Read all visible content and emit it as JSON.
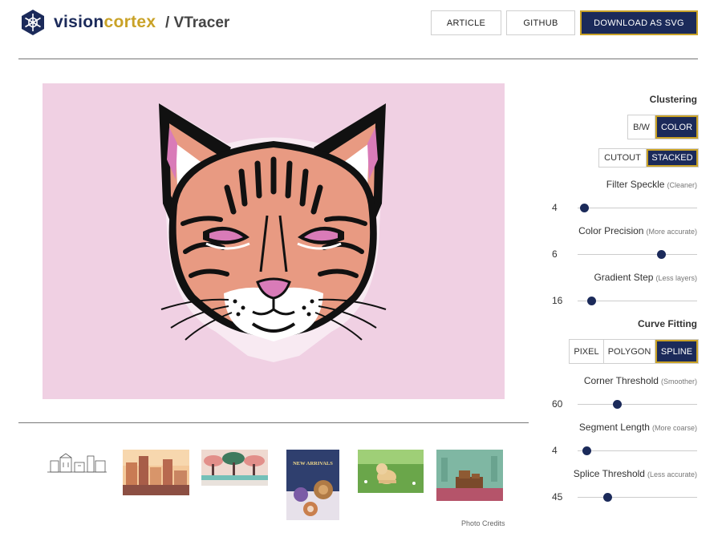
{
  "header": {
    "brand_prefix": "vision",
    "brand_accent": "cortex",
    "product": "/ VTracer",
    "nav": {
      "article": "ARTICLE",
      "github": "GITHUB",
      "download": "DOWNLOAD AS SVG"
    }
  },
  "canvas": {
    "background": "#f0d0e3",
    "subject": "lynx-face"
  },
  "gallery": {
    "thumbnails": [
      "line-drawing-thumbnail",
      "city-skyline-thumbnail",
      "trees-landscape-thumbnail",
      "new-arrivals-poster-thumbnail",
      "dog-on-grass-thumbnail",
      "pixel-art-thumbnail"
    ],
    "poster_text": "NEW ARRIVALS",
    "credits": "Photo Credits"
  },
  "panel": {
    "clustering": {
      "title": "Clustering",
      "mode_options": [
        "B/W",
        "COLOR"
      ],
      "mode_selected": "COLOR",
      "layer_options": [
        "CUTOUT",
        "STACKED"
      ],
      "layer_selected": "STACKED"
    },
    "sliders_clustering": [
      {
        "label": "Filter Speckle",
        "hint": "(Cleaner)",
        "value": "4",
        "fraction": 0.06
      },
      {
        "label": "Color Precision",
        "hint": "(More accurate)",
        "value": "6",
        "fraction": 0.7
      },
      {
        "label": "Gradient Step",
        "hint": "(Less layers)",
        "value": "16",
        "fraction": 0.12
      }
    ],
    "curve_fitting": {
      "title": "Curve Fitting",
      "options": [
        "PIXEL",
        "POLYGON",
        "SPLINE"
      ],
      "selected": "SPLINE"
    },
    "sliders_curve": [
      {
        "label": "Corner Threshold",
        "hint": "(Smoother)",
        "value": "60",
        "fraction": 0.33
      },
      {
        "label": "Segment Length",
        "hint": "(More coarse)",
        "value": "4",
        "fraction": 0.08
      },
      {
        "label": "Splice Threshold",
        "hint": "(Less accurate)",
        "value": "45",
        "fraction": 0.25
      }
    ]
  },
  "colors": {
    "navy": "#1b2a5a",
    "gold": "#c9a227",
    "canvas_pink": "#f0d0e3",
    "fur": "#e89a82",
    "eye": "#d97bb8"
  }
}
